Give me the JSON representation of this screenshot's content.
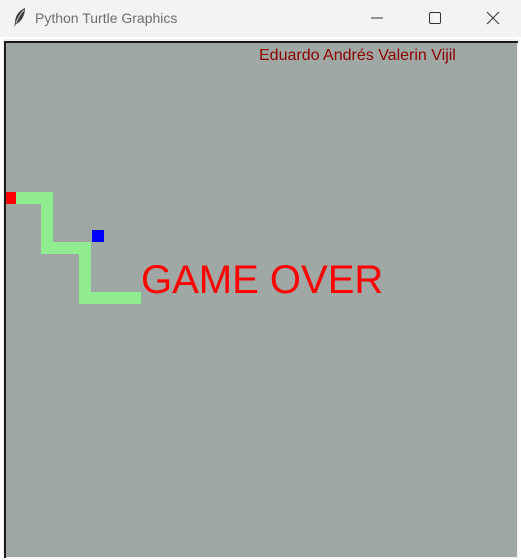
{
  "window": {
    "title": "Python Turtle Graphics",
    "icon": "feather-icon",
    "controls": [
      "minimize-icon",
      "maximize-icon",
      "close-icon"
    ]
  },
  "game": {
    "author": "Eduardo Andrés Valerin Vijil",
    "message": "GAME OVER",
    "colors": {
      "background": "#a0a8a6",
      "snake_body": "#90ee90",
      "snake_head": "#ff0000",
      "food": "#0000ff",
      "message": "#ff0000",
      "author": "#8b0000"
    }
  }
}
